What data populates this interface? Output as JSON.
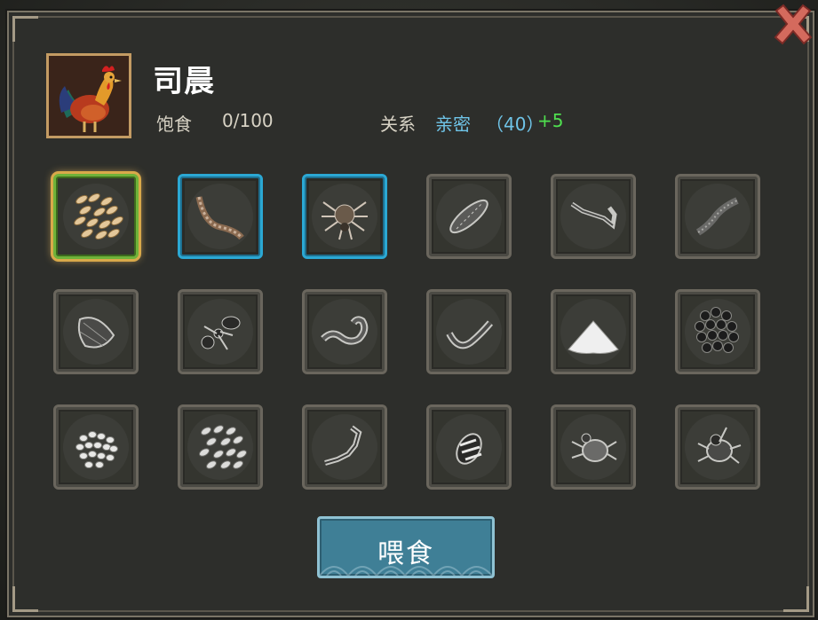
{
  "pet": {
    "name": "司晨",
    "portrait_icon": "rooster-portrait",
    "satiety_label": "饱食",
    "satiety_value": "0/100",
    "satiety_current": 0,
    "satiety_max": 100,
    "relation_label": "关系",
    "relation_level": "亲密",
    "relation_points": "（40）",
    "relation_bonus": "+5"
  },
  "colors": {
    "relation": "#6fc4e8",
    "bonus": "#4fe04f",
    "selected_border": "#6fb23a",
    "highlight_border": "#2ba8d4",
    "button": "#3f7f96"
  },
  "food_items": [
    {
      "icon": "grain-icon",
      "state": "selected"
    },
    {
      "icon": "centipede-icon",
      "state": "highlighted"
    },
    {
      "icon": "spider-icon",
      "state": "highlighted"
    },
    {
      "icon": "woodlouse-icon",
      "state": "normal"
    },
    {
      "icon": "scorpion-dark-icon",
      "state": "normal"
    },
    {
      "icon": "millipede-icon",
      "state": "normal"
    },
    {
      "icon": "cicada-icon",
      "state": "normal"
    },
    {
      "icon": "ant-icon",
      "state": "normal"
    },
    {
      "icon": "worm-icon",
      "state": "normal"
    },
    {
      "icon": "salamander-icon",
      "state": "normal"
    },
    {
      "icon": "salt-pile-icon",
      "state": "normal"
    },
    {
      "icon": "black-beans-icon",
      "state": "normal"
    },
    {
      "icon": "rice-icon",
      "state": "normal"
    },
    {
      "icon": "white-grain-icon",
      "state": "normal"
    },
    {
      "icon": "scorpion-icon",
      "state": "normal"
    },
    {
      "icon": "bee-icon",
      "state": "normal"
    },
    {
      "icon": "tick-icon",
      "state": "normal"
    },
    {
      "icon": "beetle-icon",
      "state": "normal"
    }
  ],
  "feed_button": {
    "label": "喂食"
  },
  "close_icon": "close-icon"
}
